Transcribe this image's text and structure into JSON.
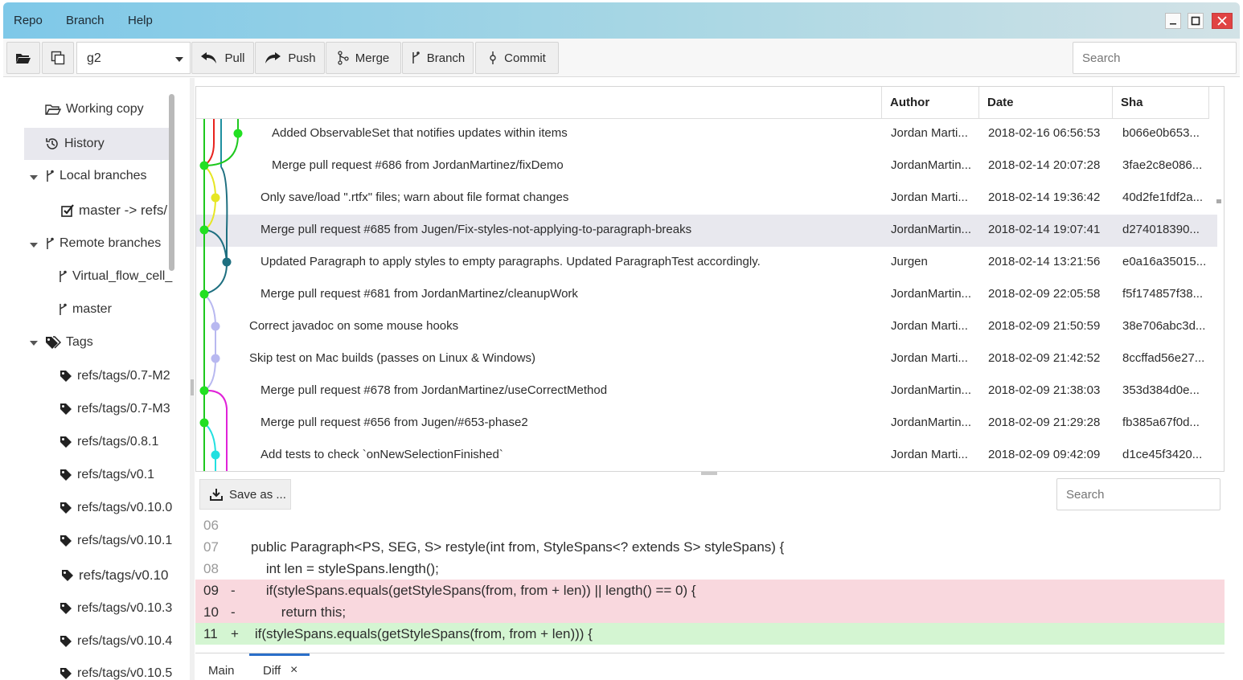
{
  "menu": {
    "items": [
      "Repo",
      "Branch",
      "Help"
    ]
  },
  "toolbar": {
    "branch_value": "g2",
    "pull_label": "Pull",
    "push_label": "Push",
    "merge_label": "Merge",
    "branch_label": "Branch",
    "commit_label": "Commit",
    "search_placeholder": "Search"
  },
  "sidebar": {
    "working_copy": "Working copy",
    "history": "History",
    "local_branches": "Local branches",
    "local_items": [
      "master -> refs/"
    ],
    "remote_branches": "Remote branches",
    "remote_items": [
      "Virtual_flow_cell_",
      "master"
    ],
    "tags": "Tags",
    "tag_items": [
      "refs/tags/0.7-M2",
      "refs/tags/0.7-M3",
      "refs/tags/0.8.1",
      "refs/tags/v0.1",
      "refs/tags/v0.10.0",
      "refs/tags/v0.10.1",
      "refs/tags/v0.10",
      "refs/tags/v0.10.3",
      "refs/tags/v0.10.4",
      "refs/tags/v0.10.5"
    ]
  },
  "history": {
    "columns": {
      "author": "Author",
      "date": "Date",
      "sha": "Sha"
    },
    "rows": [
      {
        "message": "Added ObservableSet that notifies updates within items",
        "author": "Jordan Marti...",
        "date": "2018-02-16 06:56:53",
        "sha": "b066e0b653..."
      },
      {
        "message": "Merge pull request #686 from JordanMartinez/fixDemo",
        "author": "JordanMartin...",
        "date": "2018-02-14 20:07:28",
        "sha": "3fae2c8e086..."
      },
      {
        "message": "Only save/load \".rtfx\" files; warn about file format changes",
        "author": "Jordan Marti...",
        "date": "2018-02-14 19:36:42",
        "sha": "40d2fe1fdf2a..."
      },
      {
        "message": "Merge pull request #685 from Jugen/Fix-styles-not-applying-to-paragraph-breaks",
        "author": "JordanMartin...",
        "date": "2018-02-14 19:07:41",
        "sha": "d274018390..."
      },
      {
        "message": "Updated Paragraph to apply styles to empty paragraphs. Updated ParagraphTest accordingly.",
        "author": "Jurgen",
        "date": "2018-02-14 13:21:56",
        "sha": "e0a16a35015..."
      },
      {
        "message": "Merge pull request #681 from JordanMartinez/cleanupWork",
        "author": "JordanMartin...",
        "date": "2018-02-09 22:05:58",
        "sha": "f5f174857f38..."
      },
      {
        "message": "Correct javadoc on some mouse hooks",
        "author": "Jordan Marti...",
        "date": "2018-02-09 21:50:59",
        "sha": "38e706abc3d..."
      },
      {
        "message": "Skip test on Mac builds (passes on Linux & Windows)",
        "author": "Jordan Marti...",
        "date": "2018-02-09 21:42:52",
        "sha": "8ccffad56e27..."
      },
      {
        "message": "Merge pull request #678 from JordanMartinez/useCorrectMethod",
        "author": "JordanMartin...",
        "date": "2018-02-09 21:38:03",
        "sha": "353d384d0e..."
      },
      {
        "message": "Merge pull request #656 from Jugen/#653-phase2",
        "author": "JordanMartin...",
        "date": "2018-02-09 21:29:28",
        "sha": "fb385a67f0d..."
      },
      {
        "message": "Add tests to check `onNewSelectionFinished`",
        "author": "Jordan Marti...",
        "date": "2018-02-09 09:42:09",
        "sha": "d1ce45f3420..."
      }
    ]
  },
  "diff": {
    "save_label": "Save as ...",
    "search_placeholder": "Search",
    "lines": [
      {
        "num": "06",
        "mark": "",
        "text": "",
        "kind": "ctx"
      },
      {
        "num": "07",
        "mark": "",
        "text": "public Paragraph<PS, SEG, S> restyle(int from, StyleSpans<? extends S> styleSpans) {",
        "kind": "ctx"
      },
      {
        "num": "08",
        "mark": "",
        "text": "    int len = styleSpans.length();",
        "kind": "ctx"
      },
      {
        "num": "09",
        "mark": "-",
        "text": "    if(styleSpans.equals(getStyleSpans(from, from + len)) || length() == 0) {",
        "kind": "del"
      },
      {
        "num": "10",
        "mark": "-",
        "text": "        return this;",
        "kind": "del"
      },
      {
        "num": "11",
        "mark": "+",
        "text": "    if(styleSpans.equals(getStyleSpans(from, from + len))) {",
        "kind": "add"
      }
    ]
  },
  "tabs": {
    "main": "Main",
    "diff": "Diff",
    "close": "×"
  }
}
